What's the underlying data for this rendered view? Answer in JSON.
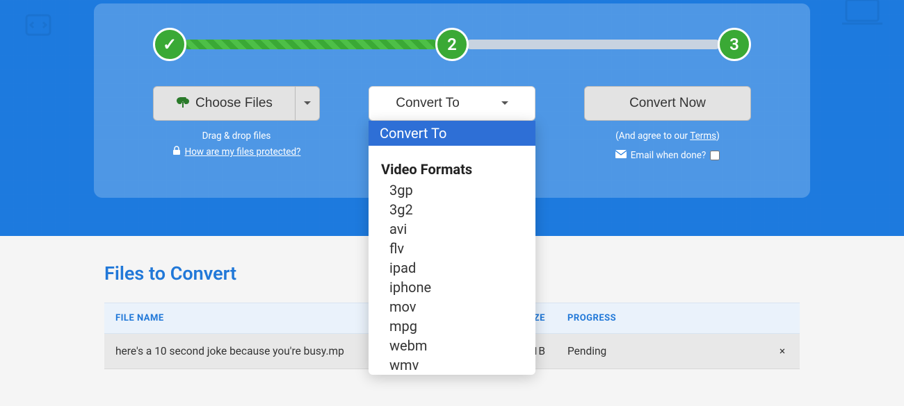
{
  "steps": {
    "step1": "✓",
    "step2": "2",
    "step3": "3"
  },
  "choose": {
    "label": "Choose Files",
    "hint": "Drag & drop files",
    "protect_link": "How are my files protected?"
  },
  "convert": {
    "label": "Convert To",
    "dropdown_header": "Convert To",
    "group_label": "Video Formats",
    "items": [
      "3gp",
      "3g2",
      "avi",
      "flv",
      "ipad",
      "iphone",
      "mov",
      "mpg",
      "webm",
      "wmv"
    ]
  },
  "action": {
    "label": "Convert Now",
    "agree_prefix": "(And agree to our ",
    "agree_link": "Terms",
    "agree_suffix": ")",
    "email_label": "Email when done?"
  },
  "files": {
    "title_a": "Files to ",
    "title_b": "Convert",
    "columns": {
      "name": "FILE NAME",
      "size": "ZE",
      "progress": "PROGRESS"
    },
    "rows": [
      {
        "name": "here's a 10 second joke because you're busy.mp",
        "size": "1B",
        "progress": "Pending"
      }
    ]
  }
}
